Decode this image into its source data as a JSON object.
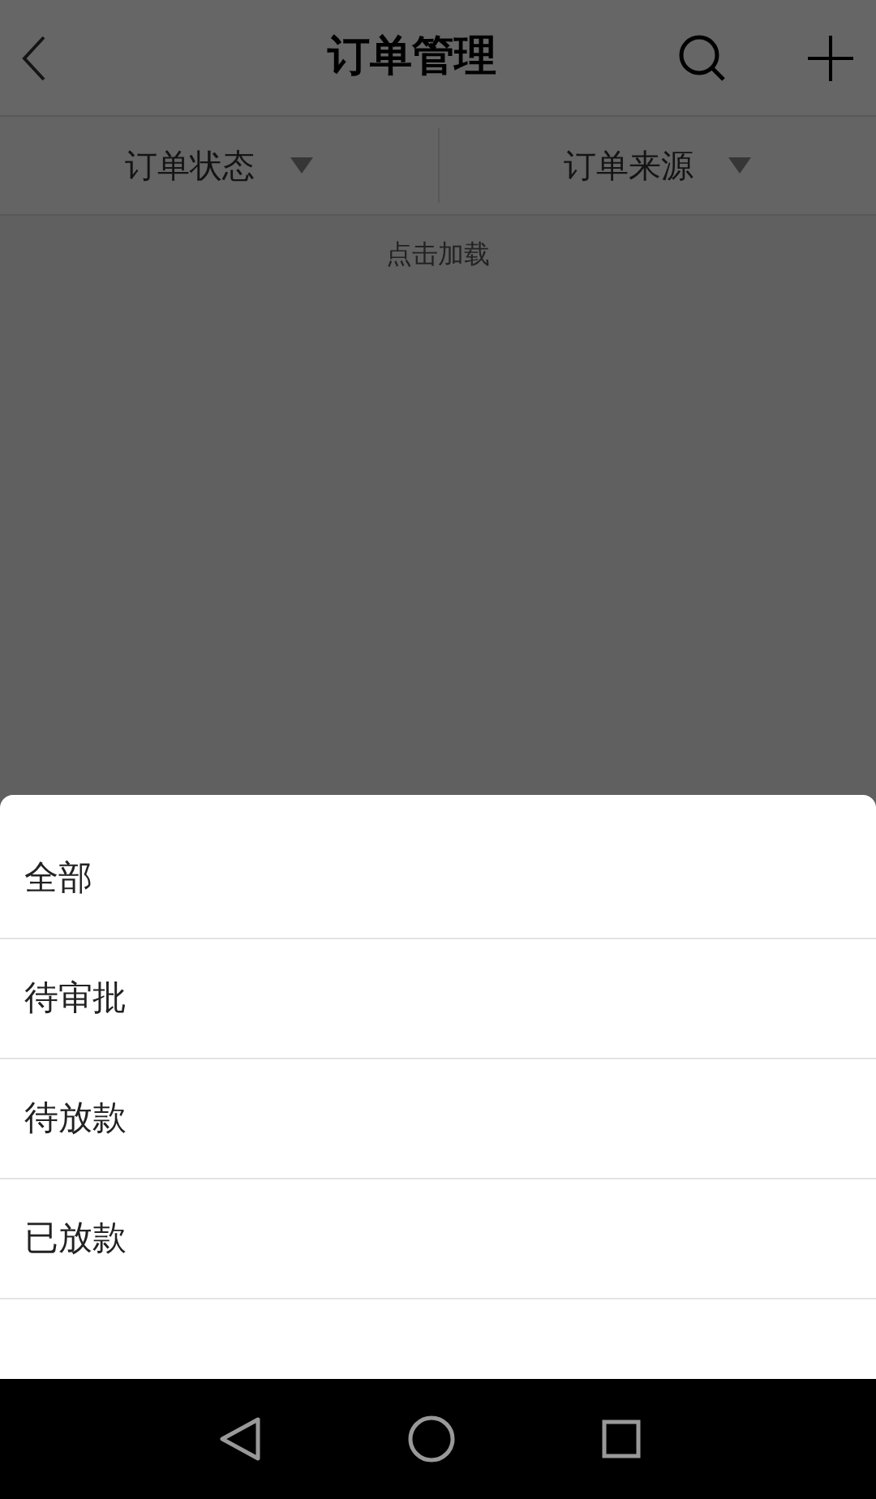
{
  "header": {
    "title": "订单管理"
  },
  "filters": [
    {
      "label": "订单状态"
    },
    {
      "label": "订单来源"
    }
  ],
  "load_more": "点击加载",
  "sheet": {
    "options": [
      {
        "label": "全部"
      },
      {
        "label": "待审批"
      },
      {
        "label": "待放款"
      },
      {
        "label": "已放款"
      }
    ]
  }
}
